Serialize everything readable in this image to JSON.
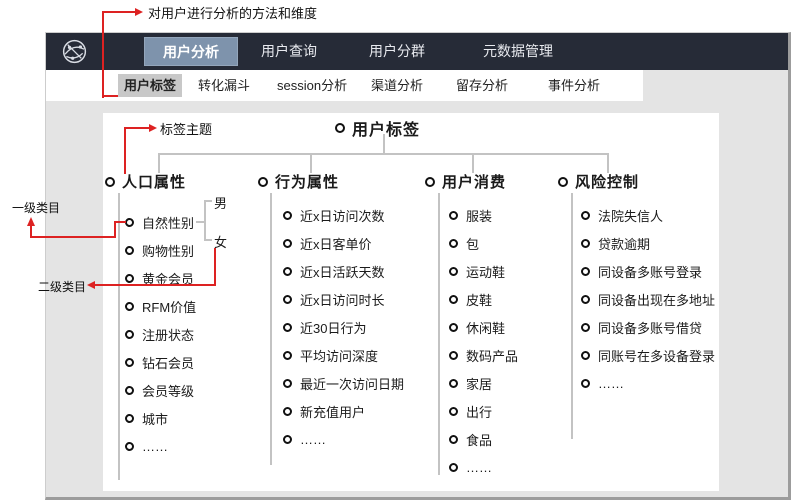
{
  "annotations": {
    "top": "对用户进行分析的方法和维度",
    "tag_theme": "标签主题",
    "level1": "一级类目",
    "level2": "二级类目"
  },
  "navbar": {
    "tabs": [
      {
        "label": "用户分析",
        "active": true
      },
      {
        "label": "用户查询",
        "active": false
      },
      {
        "label": "用户分群",
        "active": false
      },
      {
        "label": "元数据管理",
        "active": false
      }
    ]
  },
  "subnav": {
    "tabs": [
      {
        "label": "用户标签",
        "active": true
      },
      {
        "label": "转化漏斗",
        "active": false
      },
      {
        "label": "session分析",
        "active": false
      },
      {
        "label": "渠道分析",
        "active": false
      },
      {
        "label": "留存分析",
        "active": false
      },
      {
        "label": "事件分析",
        "active": false
      }
    ]
  },
  "tree": {
    "root": "用户标签",
    "branches": [
      {
        "label": "人口属性",
        "items": [
          "自然性别",
          "购物性别",
          "黄金会员",
          "RFM价值",
          "注册状态",
          "钻石会员",
          "会员等级",
          "城市",
          "……"
        ]
      },
      {
        "label": "行为属性",
        "items": [
          "近x日访问次数",
          "近x日客单价",
          "近x日活跃天数",
          "近x日访问时长",
          "近30日行为",
          "平均访问深度",
          "最近一次访问日期",
          "新充值用户",
          "……"
        ]
      },
      {
        "label": "用户消费",
        "items": [
          "服装",
          "包",
          "运动鞋",
          "皮鞋",
          "休闲鞋",
          "数码产品",
          "家居",
          "出行",
          "食品",
          "……"
        ]
      },
      {
        "label": "风险控制",
        "items": [
          "法院失信人",
          "贷款逾期",
          "同设备多账号登录",
          "同设备出现在多地址",
          "同设备多账号借贷",
          "同账号在多设备登录",
          "……"
        ]
      }
    ],
    "gender_values": [
      "男",
      "女"
    ]
  },
  "colors": {
    "annotation_red": "#dd2222",
    "navbar_bg": "#262b37",
    "active_nav_tab_bg": "#7e93ac",
    "active_subtab_bg": "#c8c8c8",
    "panel_bg": "#e4e4e4",
    "tree_line": "#c3c3c3"
  }
}
